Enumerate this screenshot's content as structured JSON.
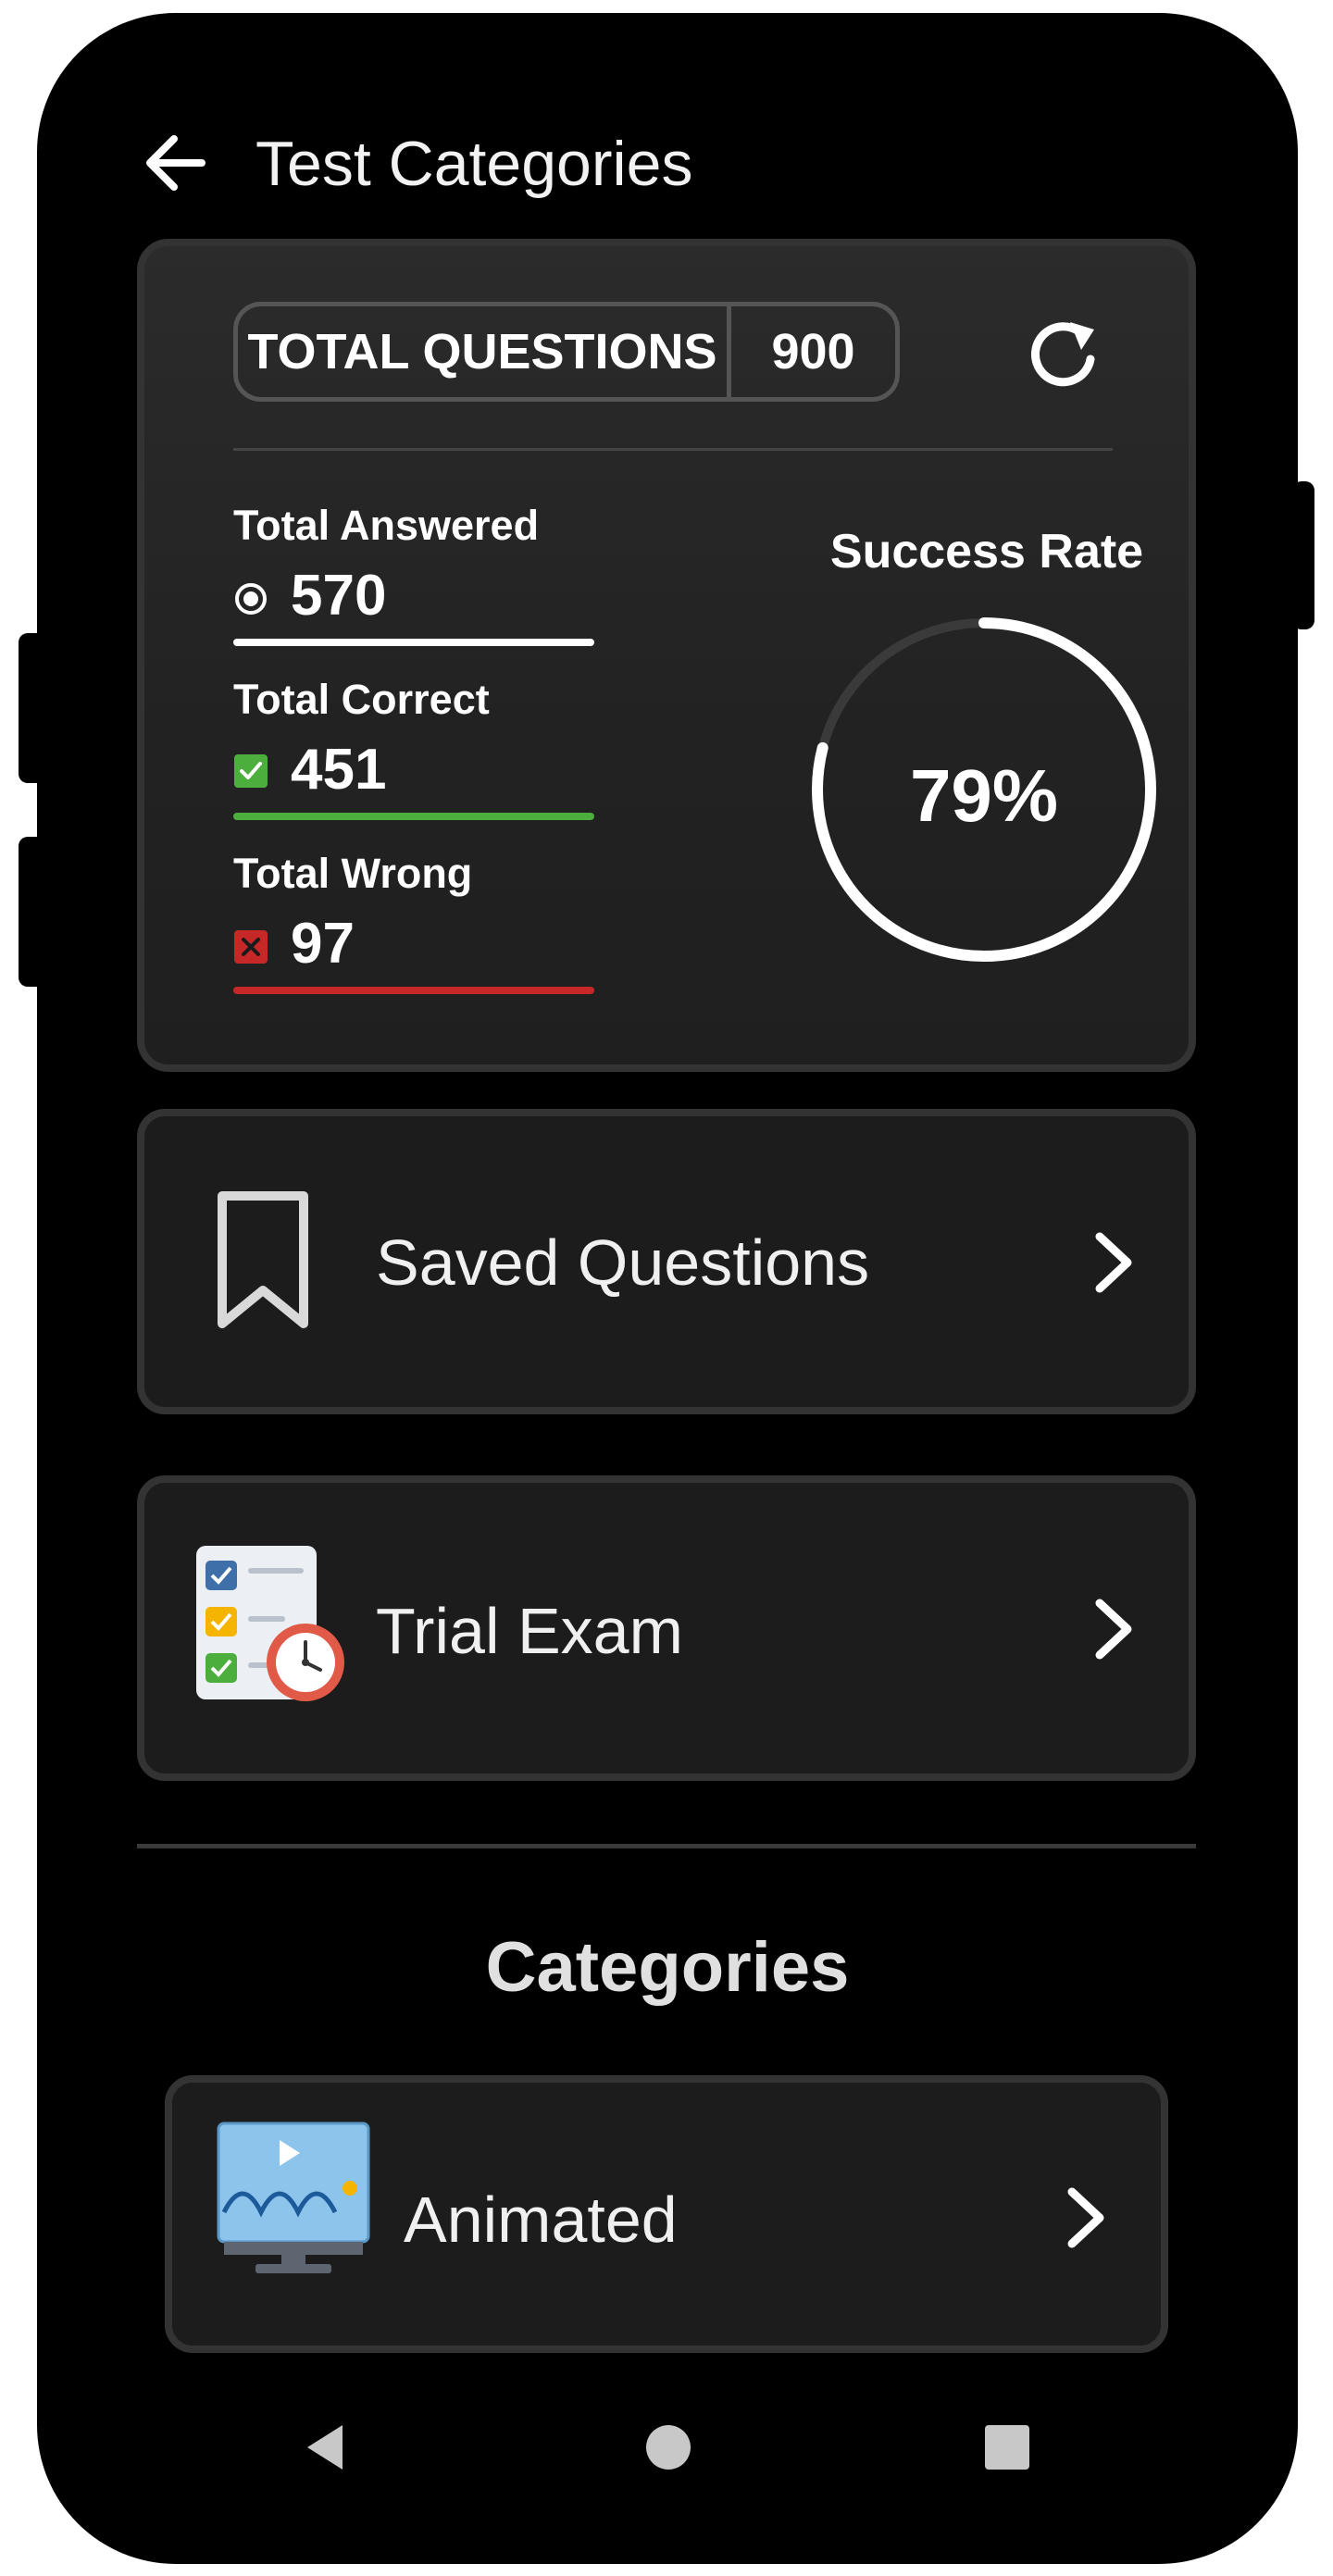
{
  "header": {
    "title": "Test Categories"
  },
  "stats": {
    "total_questions_label": "TOTAL QUESTIONS",
    "total_questions_value": "900",
    "answered": {
      "label": "Total Answered",
      "value": "570",
      "color": "#ffffff"
    },
    "correct": {
      "label": "Total Correct",
      "value": "451",
      "color": "#4caf3d"
    },
    "wrong": {
      "label": "Total Wrong",
      "value": "97",
      "color": "#c62828"
    },
    "success_rate": {
      "label": "Success Rate",
      "text": "79%",
      "value": 0.79
    }
  },
  "menu": {
    "saved": {
      "label": "Saved Questions",
      "icon": "bookmark-icon"
    },
    "trial": {
      "label": "Trial Exam",
      "icon": "exam-clock-icon"
    }
  },
  "categories": {
    "title": "Categories",
    "items": [
      {
        "label": "Animated",
        "icon": "animated-monitor-icon"
      }
    ]
  },
  "nav": {
    "back": "triangle",
    "home": "circle",
    "recents": "square"
  }
}
